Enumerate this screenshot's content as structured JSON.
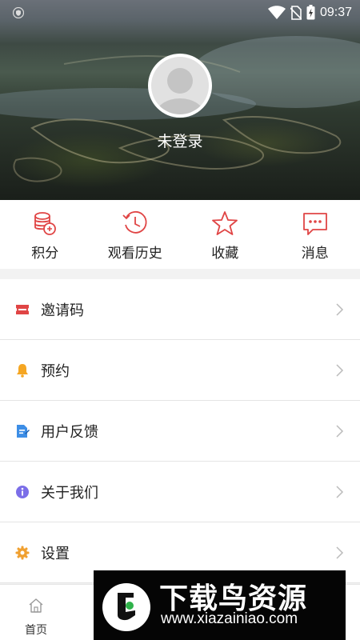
{
  "status_bar": {
    "time": "09:37",
    "icons": [
      "shield-icon",
      "wifi-icon",
      "no-sim-icon",
      "battery-charging-icon"
    ]
  },
  "profile": {
    "login_status": "未登录",
    "avatar_icon": "default-avatar-icon"
  },
  "quick_actions": [
    {
      "label": "积分",
      "icon": "coins-icon"
    },
    {
      "label": "观看历史",
      "icon": "history-clock-icon"
    },
    {
      "label": "收藏",
      "icon": "star-icon"
    },
    {
      "label": "消息",
      "icon": "message-icon"
    }
  ],
  "menu": [
    {
      "label": "邀请码",
      "icon": "ticket-icon",
      "color": "#e04545"
    },
    {
      "label": "预约",
      "icon": "bell-icon",
      "color": "#f5a623"
    },
    {
      "label": "用户反馈",
      "icon": "feedback-icon",
      "color": "#3d8ee6"
    },
    {
      "label": "关于我们",
      "icon": "info-icon",
      "color": "#7b6ee8"
    },
    {
      "label": "设置",
      "icon": "gear-icon",
      "color": "#f0a030"
    }
  ],
  "tab_bar": {
    "items": [
      {
        "label": "首页",
        "icon": "home-icon"
      }
    ]
  },
  "watermark": {
    "title": "下载鸟资源",
    "url": "www.xiazainiao.com"
  },
  "colors": {
    "accent": "#e04545",
    "text": "#222222",
    "background": "#f2f2f2"
  }
}
